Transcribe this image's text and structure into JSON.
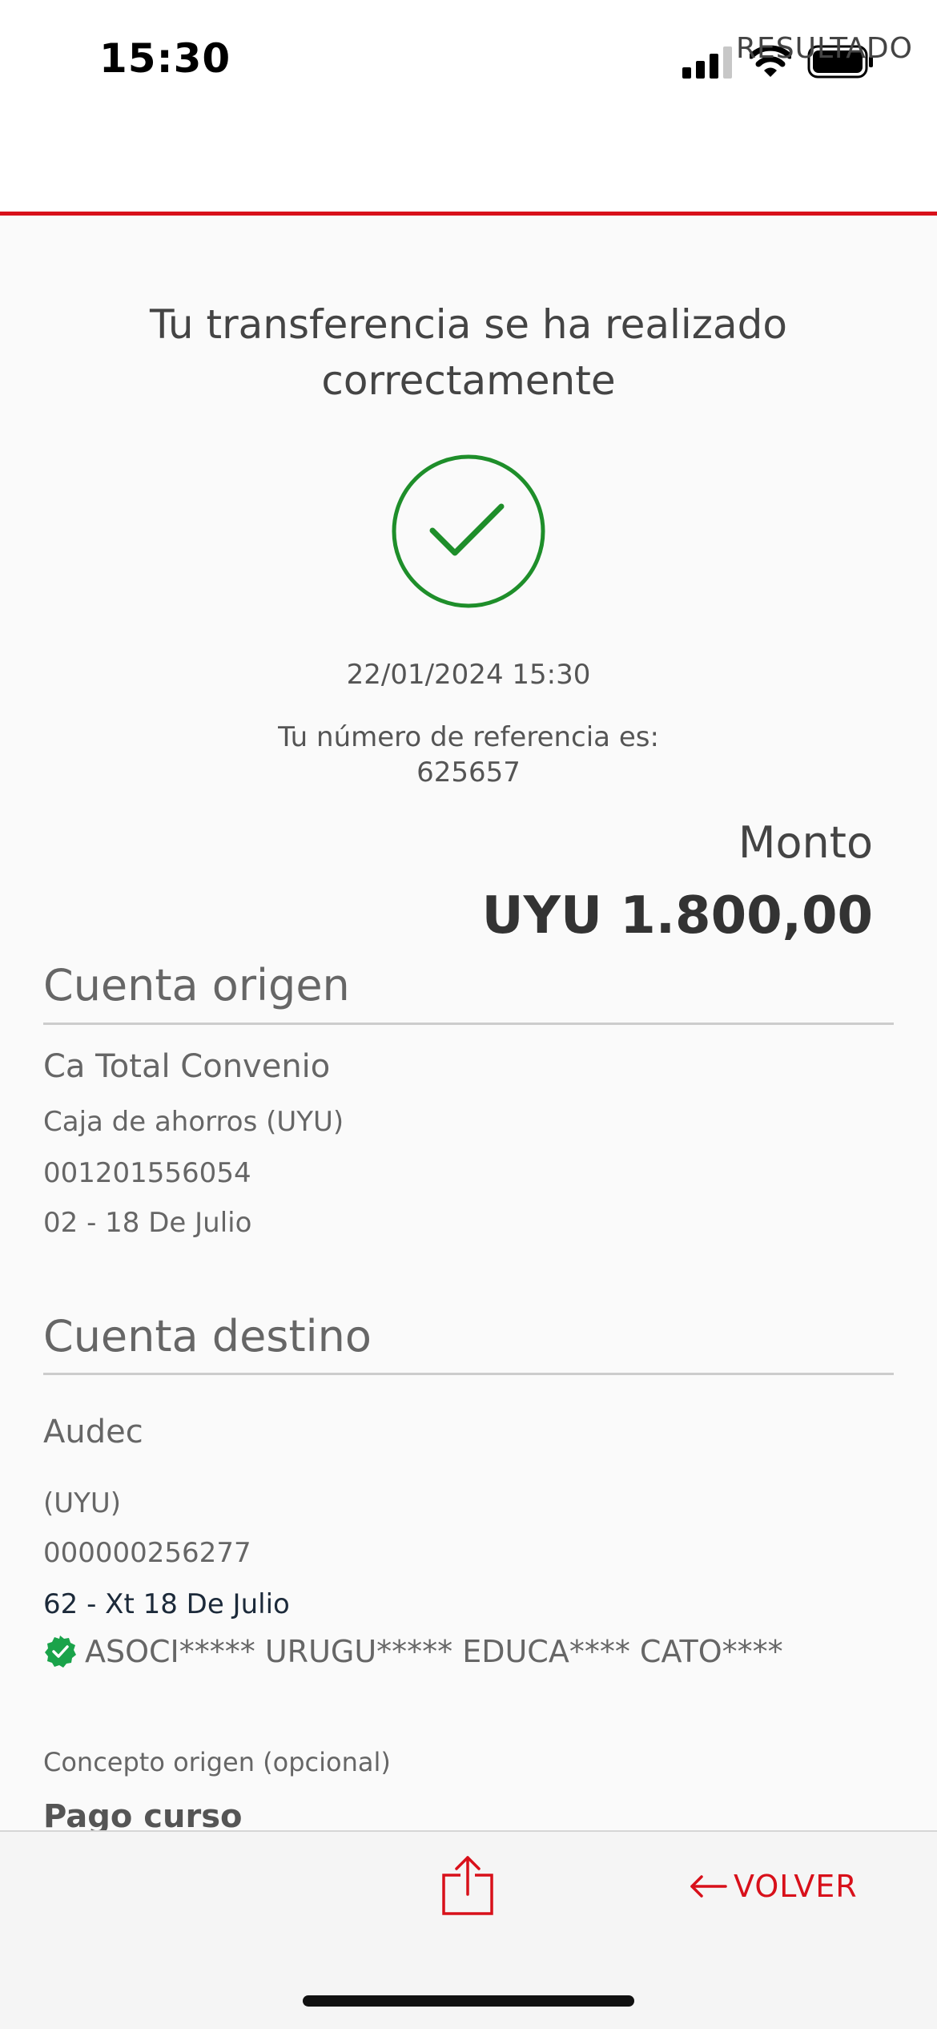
{
  "status_bar": {
    "time": "15:30"
  },
  "header": {
    "title": "RESULTADO"
  },
  "result": {
    "message": "Tu transferencia se ha realizado correctamente",
    "datetime": "22/01/2024 15:30",
    "reference_label": "Tu número de referencia es:",
    "reference_number": "625657",
    "amount_label": "Monto",
    "amount_value": "UYU 1.800,00"
  },
  "origin_account": {
    "section_title": "Cuenta origen",
    "name": "Ca Total Convenio",
    "type": "Caja de ahorros (UYU)",
    "number": "001201556054",
    "branch": "02 - 18 De Julio"
  },
  "destination_account": {
    "section_title": "Cuenta destino",
    "name": "Audec",
    "currency": "(UYU)",
    "number": "000000256277",
    "branch": "62 - Xt 18 De Julio",
    "holder": "ASOCI***** URUGU***** EDUCA**** CATO****"
  },
  "concept": {
    "label": "Concepto origen (opcional)",
    "value": "Pago curso"
  },
  "bottom_bar": {
    "back_label": "VOLVER"
  },
  "colors": {
    "accent_red": "#d8101a",
    "success_green": "#1e8e2a",
    "verified_green": "#1aa34a"
  },
  "icons": {
    "signal": "cellular-signal-icon",
    "wifi": "wifi-icon",
    "battery": "battery-icon",
    "success": "checkmark-circle-icon",
    "verified": "verified-check-icon",
    "share": "share-icon",
    "back": "arrow-left-icon"
  }
}
